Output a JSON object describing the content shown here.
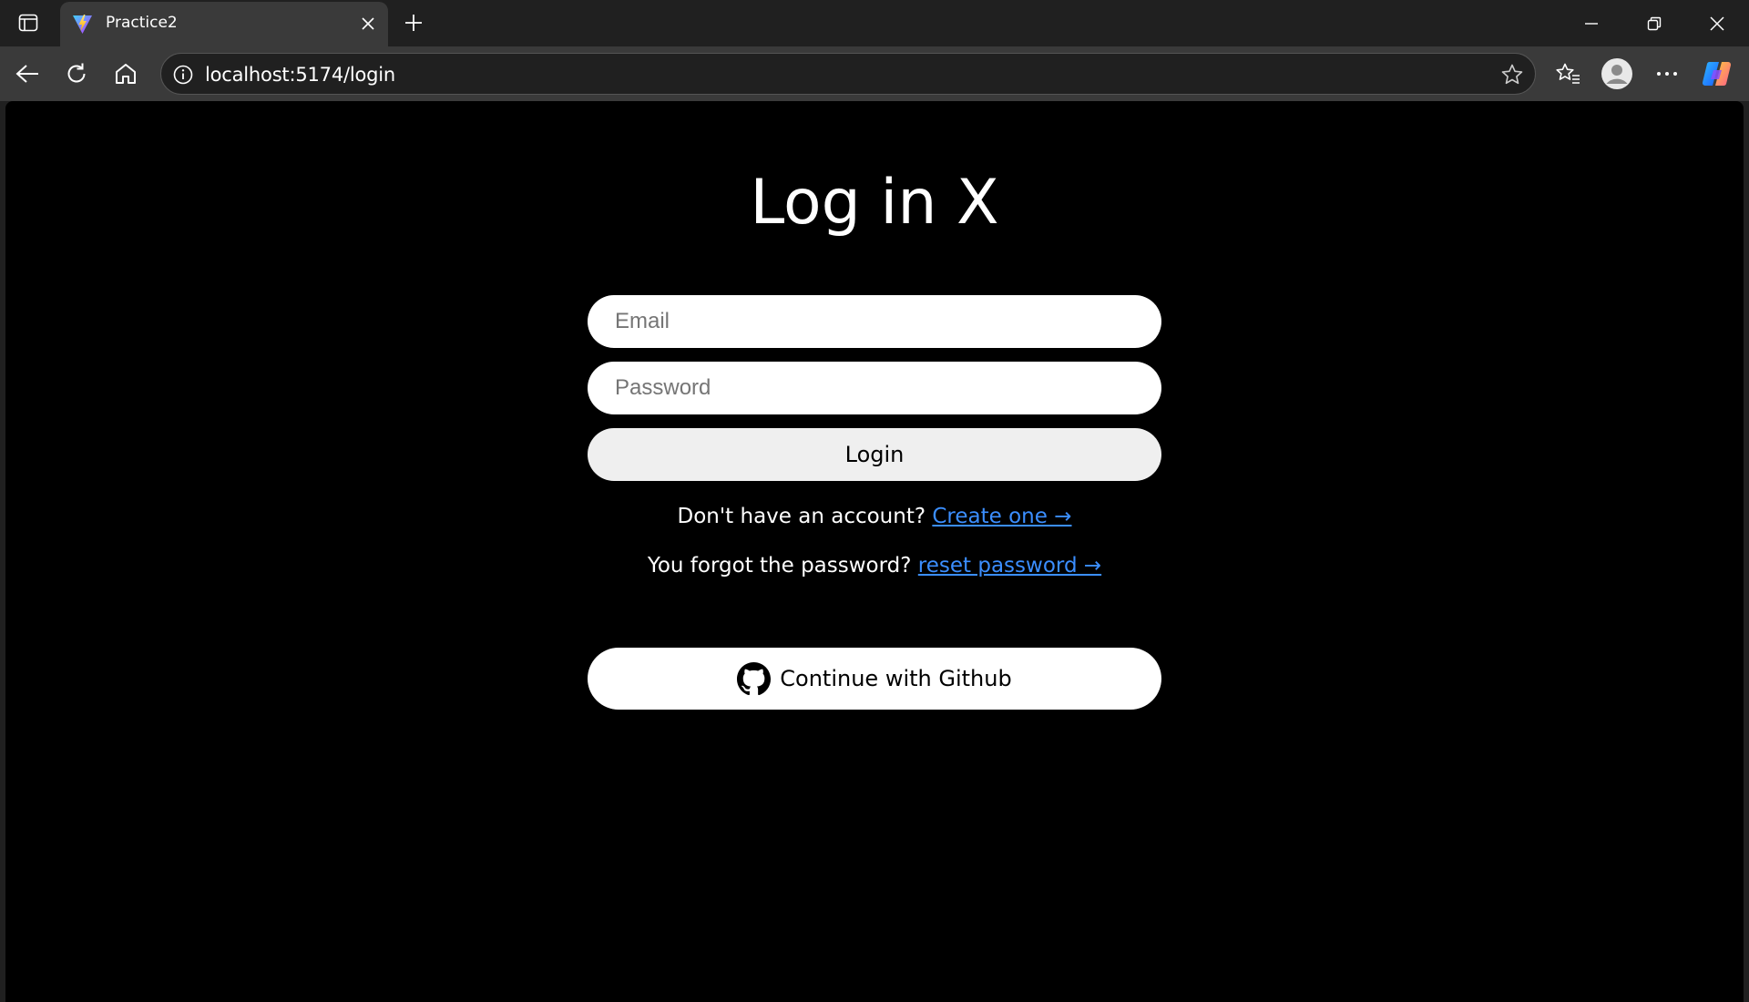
{
  "browser": {
    "tab": {
      "title": "Practice2"
    },
    "address_bar": {
      "url": "localhost:5174/login"
    },
    "icons": {
      "tab_actions": "tab-actions-icon",
      "favicon": "vite-logo-icon",
      "tab_close": "close-icon",
      "new_tab": "plus-icon",
      "minimize": "minimize-icon",
      "restore": "restore-icon",
      "close_window": "close-icon",
      "back": "back-arrow-icon",
      "refresh": "refresh-icon",
      "home": "home-icon",
      "site_info": "info-icon",
      "favorite": "star-icon",
      "favorites_list": "favorites-icon",
      "profile": "profile-avatar-icon",
      "more": "more-icon",
      "copilot": "copilot-icon"
    }
  },
  "page": {
    "background": "#000000",
    "title": "Log in X",
    "email": {
      "placeholder": "Email",
      "value": ""
    },
    "password": {
      "placeholder": "Password",
      "value": ""
    },
    "login_button": "Login",
    "create_prompt": "Don't have an account?",
    "create_link": "Create one →",
    "forgot_prompt": "You forgot the password?",
    "forgot_link": "reset password →",
    "github_button": "Continue with Github",
    "link_color": "#3b8eff"
  }
}
